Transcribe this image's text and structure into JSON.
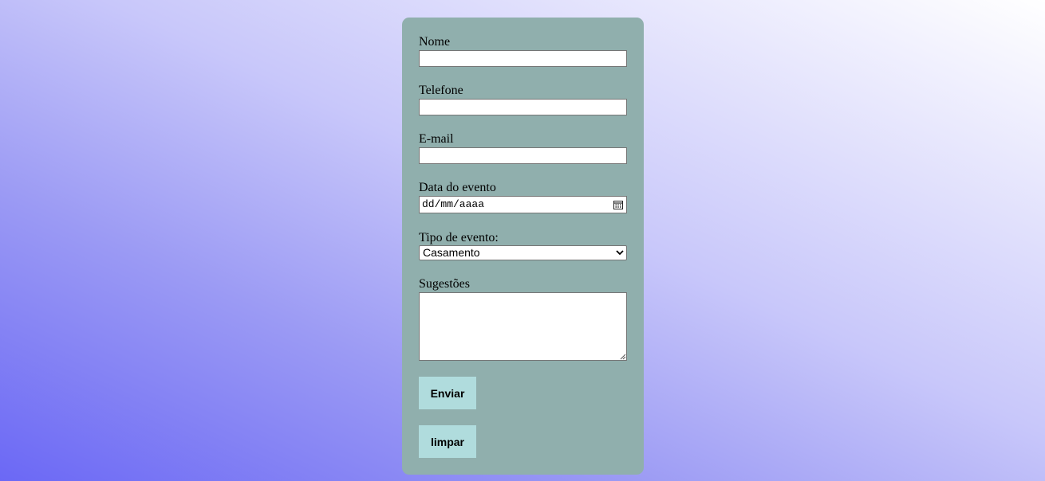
{
  "form": {
    "fields": {
      "nome": {
        "label": "Nome",
        "value": ""
      },
      "telefone": {
        "label": "Telefone",
        "value": ""
      },
      "email": {
        "label": "E-mail",
        "value": ""
      },
      "data": {
        "label": "Data do evento",
        "placeholder": "dd/mm/aaaa",
        "icon": "calendar-icon"
      },
      "tipo": {
        "label": "Tipo de evento:",
        "selected": "Casamento",
        "icon": "chevron-down-icon"
      },
      "sugestoes": {
        "label": "Sugestões",
        "value": ""
      }
    },
    "buttons": {
      "submit_label": "Enviar",
      "reset_label": "limpar"
    }
  },
  "colors": {
    "card_background": "#90afad",
    "button_background": "#b0dcdd",
    "gradient_dark": "#6b68f5",
    "gradient_light": "#ffffff"
  }
}
